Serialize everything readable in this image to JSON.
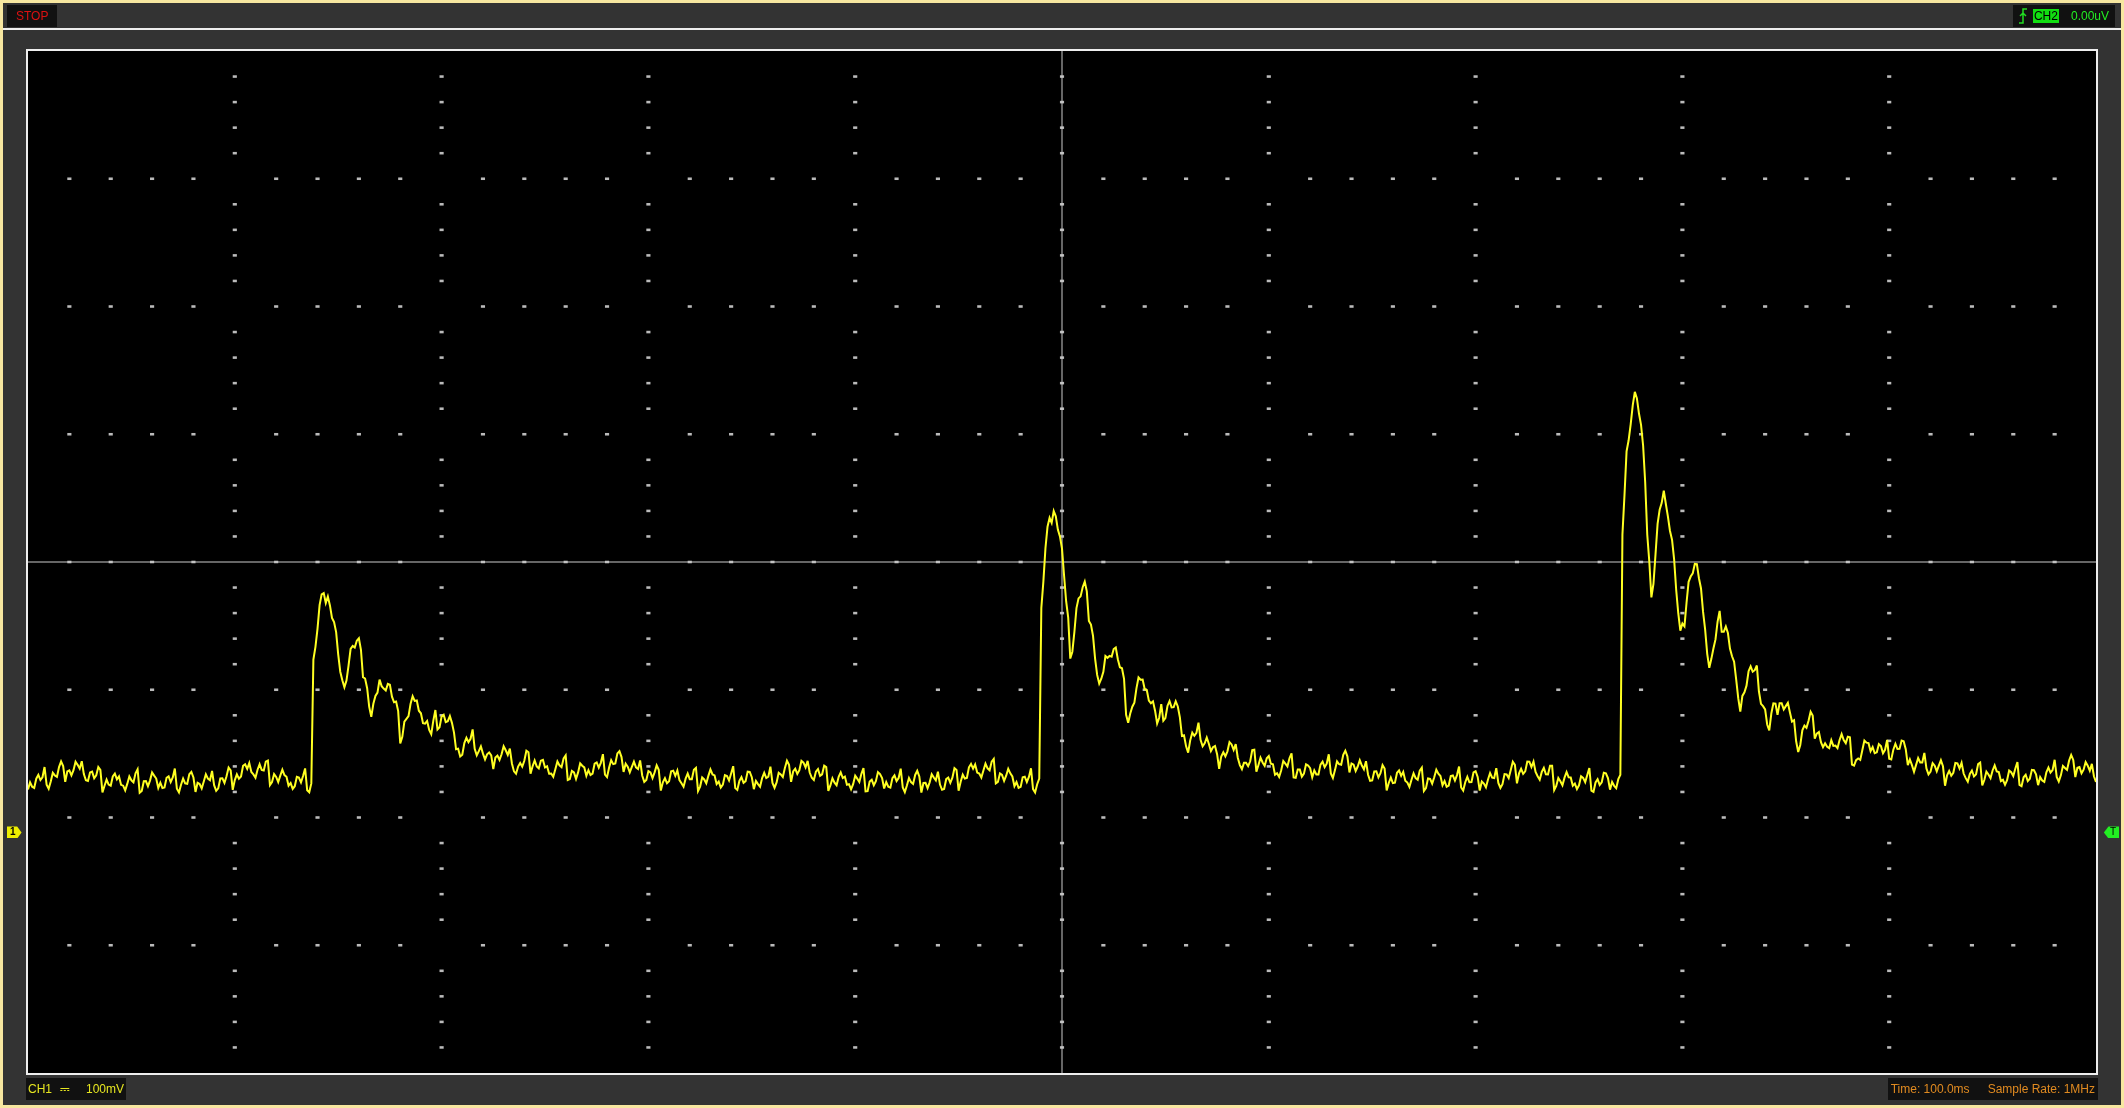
{
  "status": "STOP",
  "trigger": {
    "channel": "CH2",
    "level": "0.00uV"
  },
  "channel_marker": "1",
  "trigger_marker": "T",
  "bottom": {
    "channel": "CH1",
    "coupling": "⎓",
    "scale": "100mV",
    "time": "Time: 100.0ms",
    "sample_rate": "Sample Rate: 1MHz"
  }
}
